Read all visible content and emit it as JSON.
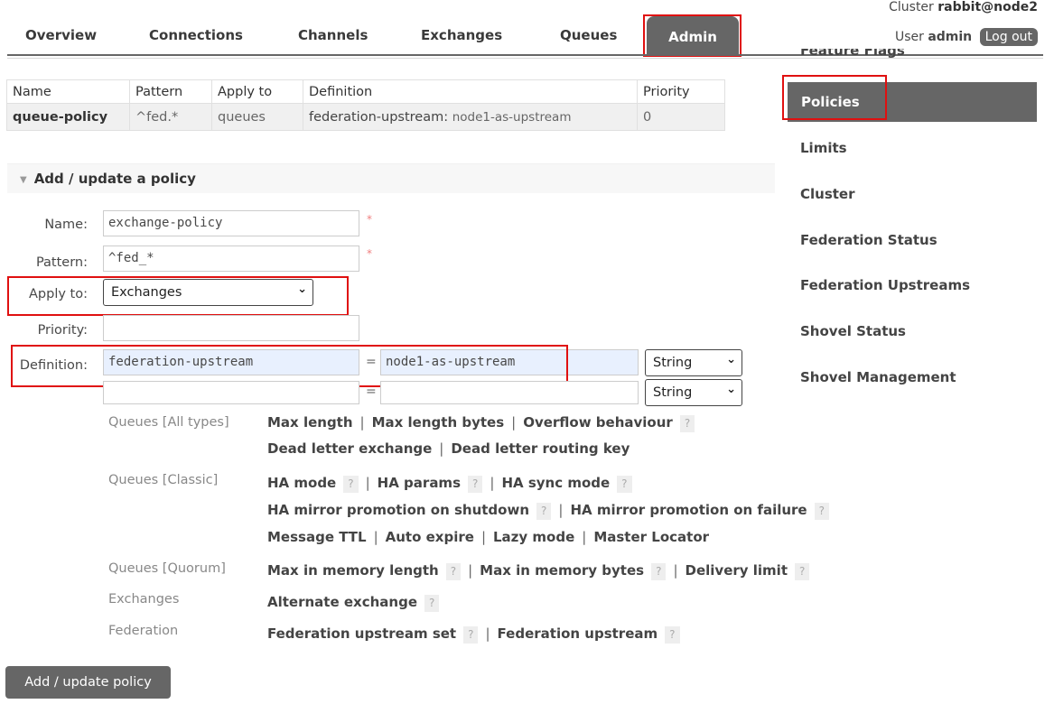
{
  "header": {
    "cluster_label": "Cluster",
    "cluster_name": "rabbit@node2",
    "user_label": "User",
    "user_name": "admin",
    "logout_label": "Log out"
  },
  "nav": {
    "tabs": [
      "Overview",
      "Connections",
      "Channels",
      "Exchanges",
      "Queues",
      "Admin"
    ],
    "active": "Admin"
  },
  "sidebar": {
    "partial_item": "Feature Flags",
    "items": [
      "Policies",
      "Limits",
      "Cluster",
      "Federation Status",
      "Federation Upstreams",
      "Shovel Status",
      "Shovel Management"
    ],
    "active": "Policies"
  },
  "policies_table": {
    "headers": [
      "Name",
      "Pattern",
      "Apply to",
      "Definition",
      "Priority"
    ],
    "rows": [
      {
        "name": "queue-policy",
        "pattern": "^fed.*",
        "apply_to": "queues",
        "definition_key": "federation-upstream:",
        "definition_value": "node1-as-upstream",
        "priority": "0"
      }
    ]
  },
  "form": {
    "section_title": "Add / update a policy",
    "name_label": "Name:",
    "name_value": "exchange-policy",
    "pattern_label": "Pattern:",
    "pattern_value": "^fed_*",
    "apply_to_label": "Apply to:",
    "apply_to_value": "Exchanges",
    "priority_label": "Priority:",
    "priority_value": "",
    "definition_label": "Definition:",
    "required_mark": "*",
    "equals": "=",
    "definition_rows": [
      {
        "key": "federation-upstream",
        "value": "node1-as-upstream",
        "type": "String"
      },
      {
        "key": "",
        "value": "",
        "type": "String"
      }
    ],
    "help_mark": "?",
    "separator": "|",
    "help_groups": [
      {
        "category": "Queues [All types]",
        "lines": [
          [
            "Max length",
            "Max length bytes",
            "Overflow behaviour ?"
          ],
          [
            "Dead letter exchange",
            "Dead letter routing key"
          ]
        ]
      },
      {
        "category": "Queues [Classic]",
        "lines": [
          [
            "HA mode ?",
            "HA params ?",
            "HA sync mode ?"
          ],
          [
            "HA mirror promotion on shutdown ?",
            "HA mirror promotion on failure ?"
          ],
          [
            "Message TTL",
            "Auto expire",
            "Lazy mode",
            "Master Locator"
          ]
        ]
      },
      {
        "category": "Queues [Quorum]",
        "lines": [
          [
            "Max in memory length ?",
            "Max in memory bytes ?",
            "Delivery limit ?"
          ]
        ]
      },
      {
        "category": "Exchanges",
        "lines": [
          [
            "Alternate exchange ?"
          ]
        ]
      },
      {
        "category": "Federation",
        "lines": [
          [
            "Federation upstream set ?",
            "Federation upstream ?"
          ]
        ]
      }
    ],
    "submit_label": "Add / update policy"
  }
}
